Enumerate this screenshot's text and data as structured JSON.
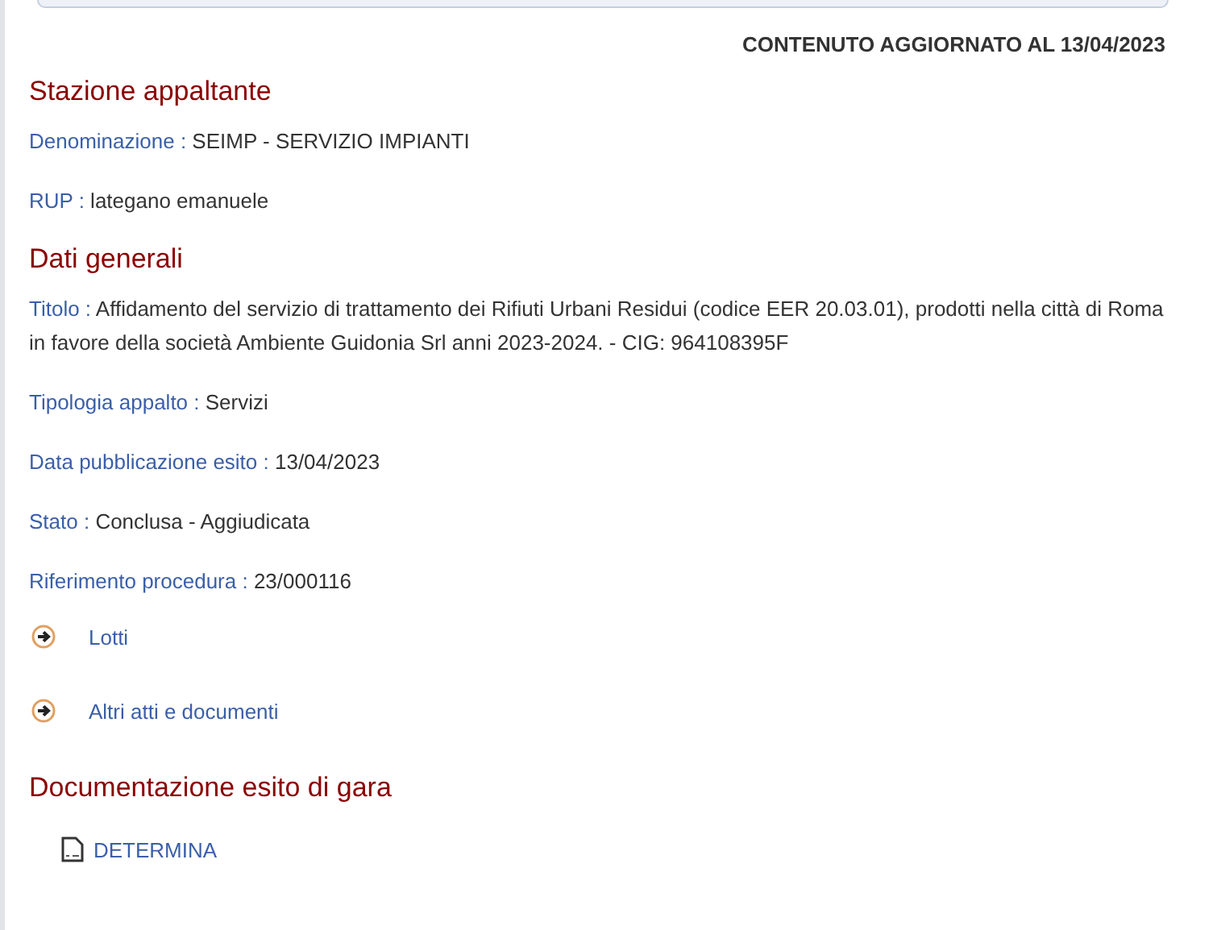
{
  "updated": "CONTENUTO AGGIORNATO AL 13/04/2023",
  "sections": [
    {
      "title": "Stazione appaltante",
      "fields": [
        {
          "label": "Denominazione :",
          "value": "SEIMP - SERVIZIO IMPIANTI"
        },
        {
          "label": "RUP :",
          "value": "lategano emanuele"
        }
      ]
    },
    {
      "title": "Dati generali",
      "fields": [
        {
          "label": "Titolo :",
          "value": "Affidamento del servizio di trattamento dei Rifiuti Urbani Residui (codice EER 20.03.01), prodotti nella città di Roma in favore della società Ambiente Guidonia Srl anni 2023-2024. - CIG: 964108395F"
        },
        {
          "label": "Tipologia appalto :",
          "value": "Servizi"
        },
        {
          "label": "Data pubblicazione esito :",
          "value": "13/04/2023"
        },
        {
          "label": "Stato :",
          "value": "Conclusa - Aggiudicata"
        },
        {
          "label": "Riferimento procedura :",
          "value": "23/000116"
        }
      ],
      "links": [
        "Lotti",
        "Altri atti e documenti"
      ]
    },
    {
      "title": "Documentazione esito di gara",
      "documents": [
        "DETERMINA"
      ]
    }
  ]
}
